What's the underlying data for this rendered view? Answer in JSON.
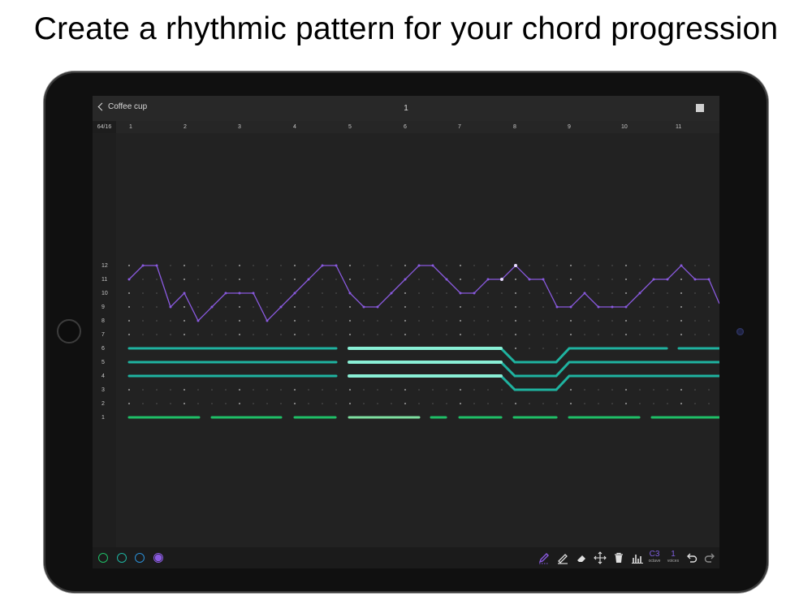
{
  "headline": "Create a rhythmic pattern for your chord progression",
  "nav": {
    "back_label": "Coffee cup",
    "title": "1"
  },
  "ruler": {
    "length": "64/16",
    "bars": [
      "1",
      "2",
      "3",
      "4",
      "5",
      "6",
      "7",
      "8",
      "9",
      "10",
      "11"
    ]
  },
  "rows": [
    "12",
    "11",
    "10",
    "9",
    "8",
    "7",
    "6",
    "5",
    "4",
    "3",
    "2",
    "1"
  ],
  "layers": [
    {
      "color": "#1fbf67"
    },
    {
      "color": "#1fb3a0"
    },
    {
      "color": "#2b8fd6"
    },
    {
      "color": "#8a5ae0"
    }
  ],
  "octave": {
    "value": "C3",
    "label": "octave"
  },
  "voices": {
    "value": "1",
    "label": "voices"
  },
  "colors": {
    "melody": "#8a5ae0",
    "chords": "#1fb3a0",
    "bass": "#1fbf67",
    "highlight": "#8af0d6"
  }
}
